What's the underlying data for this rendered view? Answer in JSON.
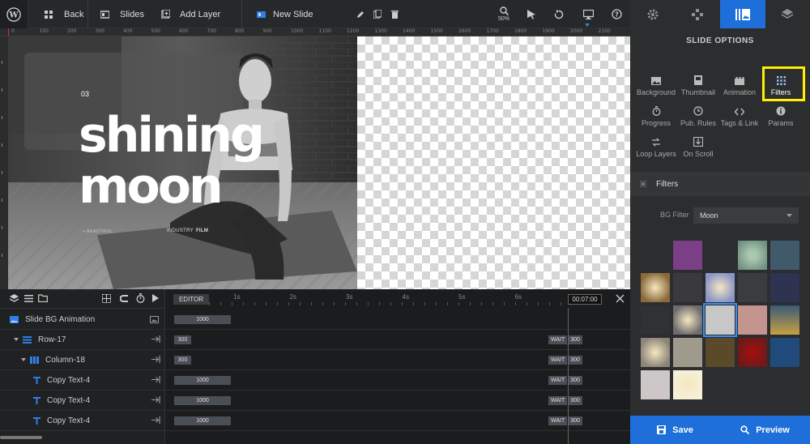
{
  "toolbar": {
    "back": "Back",
    "slides": "Slides",
    "add_layer": "Add Layer",
    "slide_name": "New Slide",
    "zoom": "50%"
  },
  "ruler": {
    "ticks": [
      "0",
      "100",
      "200",
      "300",
      "400",
      "500",
      "600",
      "700",
      "800",
      "900",
      "1000",
      "1100",
      "1200",
      "1300",
      "1400",
      "1500",
      "1600",
      "1700",
      "1800",
      "1900",
      "2000",
      "2100"
    ]
  },
  "slide": {
    "number": "03",
    "headline1": "shining",
    "headline2": "moon",
    "caption_left": "+ BEAUTIFUL",
    "caption_right_a": "INDUSTRY",
    "caption_right_b": "FILM"
  },
  "panel": {
    "title": "SLIDE OPTIONS",
    "options": [
      {
        "label": "Background",
        "icon": "image-icon"
      },
      {
        "label": "Thumbnail",
        "icon": "thumbnail-icon"
      },
      {
        "label": "Animation",
        "icon": "film-icon"
      },
      {
        "label": "Filters",
        "icon": "grid-icon"
      },
      {
        "label": "Progress",
        "icon": "stopwatch-icon"
      },
      {
        "label": "Pub. Rules",
        "icon": "clock-icon"
      },
      {
        "label": "Tags & Link",
        "icon": "code-icon"
      },
      {
        "label": "Params",
        "icon": "info-icon"
      },
      {
        "label": "Loop Layers",
        "icon": "loop-icon"
      },
      {
        "label": "On Scroll",
        "icon": "scroll-icon"
      }
    ],
    "filters_header": "Filters",
    "bg_filter_label": "BG Filter",
    "bg_filter_value": "Moon",
    "save": "Save",
    "preview": "Preview"
  },
  "swatches": [
    "#2b2d2e",
    "#7a3f86",
    "#2b2d2e",
    "#6f8f80",
    "#3f5a6a",
    "#8a6a3a",
    "#3a3a3d",
    "#8c95c6",
    "#3b3c40",
    "#2d3350",
    "#2f3234",
    "#6e6a6e",
    "#c7c7c7",
    "#c3958e",
    "#5f7a8a",
    "#8c8478",
    "#9f9a8c",
    "#5a4a2a",
    "#6a1a1a",
    "#1f4a7a",
    "#cdc7c8",
    "#f6f0d8"
  ],
  "timeline": {
    "editor": "EDITOR",
    "seconds": [
      "1s",
      "2s",
      "3s",
      "4s",
      "5s",
      "6s"
    ],
    "end_time": "00:07:00",
    "wait": "WAIT",
    "rows": [
      {
        "label": "Slide BG Animation",
        "bar": "1000",
        "wait": false,
        "wait_value": ""
      },
      {
        "label": "Row-17",
        "bar": "300",
        "wait": true,
        "wait_value": "300"
      },
      {
        "label": "Column-18",
        "bar": "300",
        "wait": true,
        "wait_value": "300"
      },
      {
        "label": "Copy Text-4",
        "bar": "1000",
        "wait": true,
        "wait_value": "300"
      },
      {
        "label": "Copy Text-4",
        "bar": "1000",
        "wait": true,
        "wait_value": "300"
      },
      {
        "label": "Copy Text-4",
        "bar": "1000",
        "wait": true,
        "wait_value": "300"
      }
    ]
  }
}
